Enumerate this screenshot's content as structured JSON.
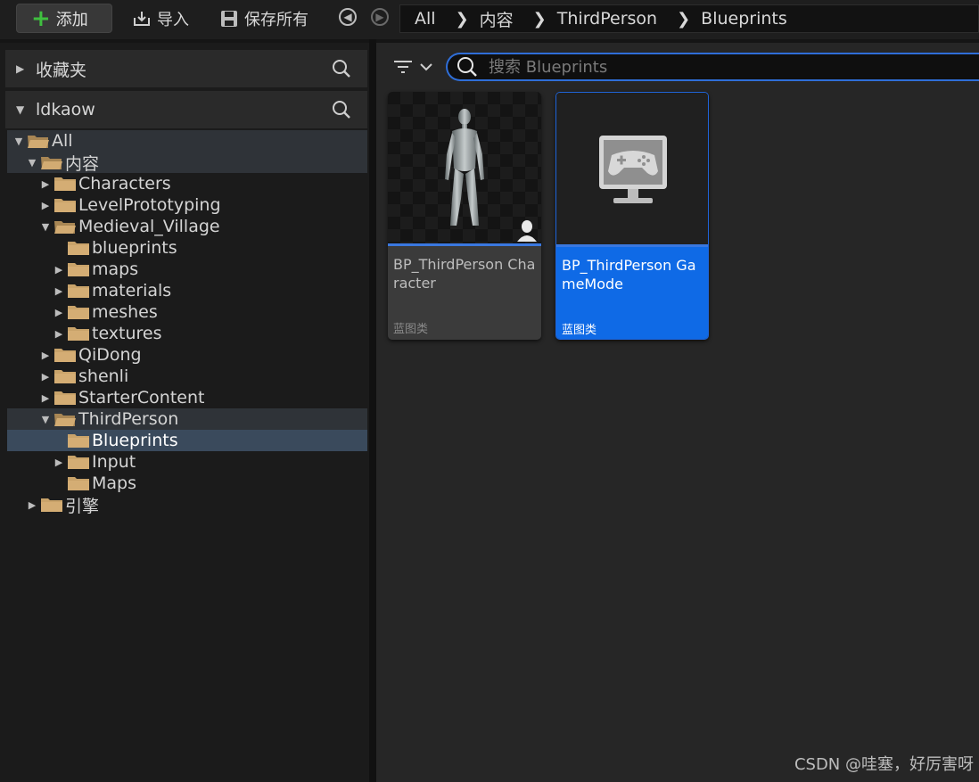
{
  "toolbar": {
    "add_label": "添加",
    "import_label": "导入",
    "save_all_label": "保存所有",
    "breadcrumb": [
      "All",
      "内容",
      "ThirdPerson",
      "Blueprints"
    ]
  },
  "favorites": {
    "title": "收藏夹"
  },
  "project": {
    "title": "ldkaow"
  },
  "tree": [
    {
      "label": "All",
      "depth": 0,
      "expanded": true,
      "state": "hl"
    },
    {
      "label": "内容",
      "depth": 1,
      "expanded": true,
      "state": "hl"
    },
    {
      "label": "Characters",
      "depth": 2,
      "expanded": false
    },
    {
      "label": "LevelPrototyping",
      "depth": 2,
      "expanded": false
    },
    {
      "label": "Medieval_Village",
      "depth": 2,
      "expanded": true
    },
    {
      "label": "blueprints",
      "depth": 3,
      "leaf": true
    },
    {
      "label": "maps",
      "depth": 3,
      "expanded": false
    },
    {
      "label": "materials",
      "depth": 3,
      "expanded": false
    },
    {
      "label": "meshes",
      "depth": 3,
      "expanded": false
    },
    {
      "label": "textures",
      "depth": 3,
      "expanded": false
    },
    {
      "label": "QiDong",
      "depth": 2,
      "expanded": false
    },
    {
      "label": "shenli",
      "depth": 2,
      "expanded": false
    },
    {
      "label": "StarterContent",
      "depth": 2,
      "expanded": false
    },
    {
      "label": "ThirdPerson",
      "depth": 2,
      "expanded": true,
      "state": "hl"
    },
    {
      "label": "Blueprints",
      "depth": 3,
      "leaf": true,
      "state": "sel"
    },
    {
      "label": "Input",
      "depth": 3,
      "expanded": false
    },
    {
      "label": "Maps",
      "depth": 3,
      "leaf": true
    },
    {
      "label": "引擎",
      "depth": 1,
      "expanded": false
    }
  ],
  "search": {
    "placeholder": "搜索 Blueprints"
  },
  "assets": [
    {
      "name": "BP_ThirdPerson Character",
      "type": "蓝图类",
      "icon": "character-icon"
    },
    {
      "name": "BP_ThirdPerson GameMode",
      "type": "蓝图类",
      "icon": "gamemode-icon",
      "selected": true
    }
  ],
  "watermark": "CSDN @哇塞，好厉害呀",
  "colors": {
    "accent": "#0f6ae6",
    "folder": "#c9a36a",
    "add_plus": "#3fbf3f"
  }
}
